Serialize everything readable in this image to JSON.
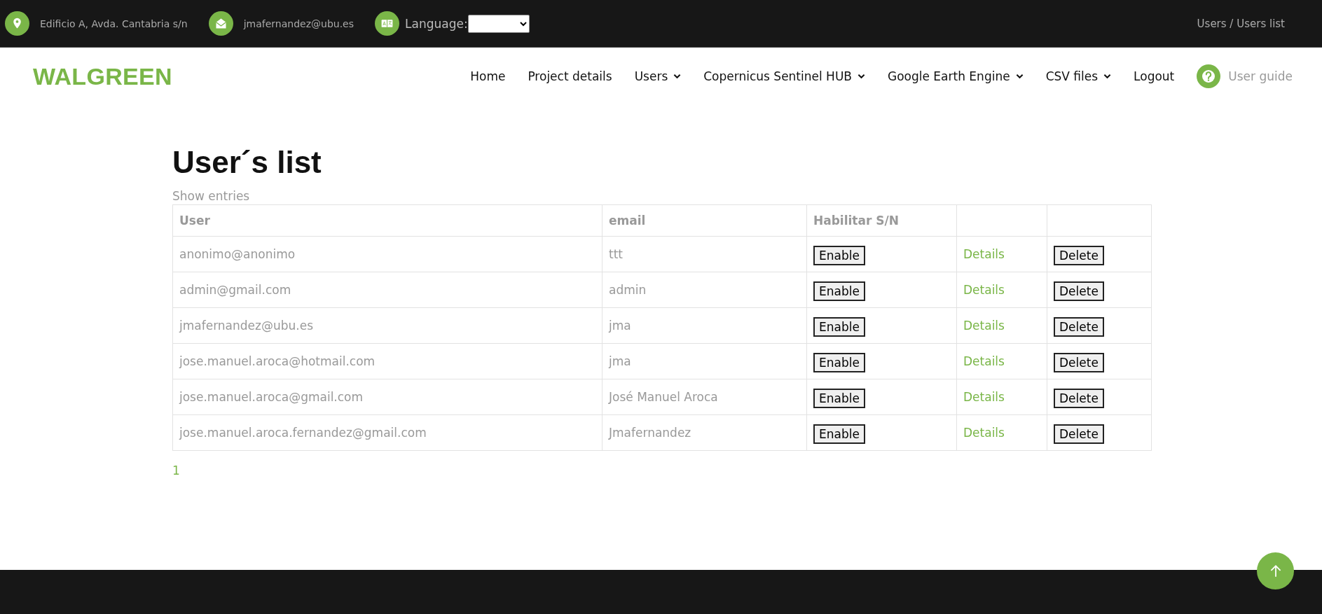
{
  "top_bar": {
    "address": "Edificio A, Avda. Cantabria s/n",
    "email": "jmafernandez@ubu.es",
    "language_label": "Language:",
    "breadcrumb": "Users / Users list"
  },
  "header": {
    "logo": "WALGREEN",
    "nav": [
      {
        "label": "Home",
        "dropdown": false
      },
      {
        "label": "Project details",
        "dropdown": false
      },
      {
        "label": "Users",
        "dropdown": true
      },
      {
        "label": "Copernicus Sentinel HUB",
        "dropdown": true
      },
      {
        "label": "Google Earth Engine",
        "dropdown": true
      },
      {
        "label": "CSV files",
        "dropdown": true
      },
      {
        "label": "Logout",
        "dropdown": false
      }
    ],
    "user_guide": "User guide"
  },
  "page_title": "User´s list",
  "show_entries": "Show entries",
  "table": {
    "columns": [
      "User",
      "email",
      "Habilitar S/N"
    ],
    "rows": [
      {
        "user": "anonimo@anonimo",
        "email": "ttt",
        "enable": "Enable",
        "details": "Details",
        "delete": "Delete"
      },
      {
        "user": "admin@gmail.com",
        "email": "admin",
        "enable": "Enable",
        "details": "Details",
        "delete": "Delete"
      },
      {
        "user": "jmafernandez@ubu.es",
        "email": "jma",
        "enable": "Enable",
        "details": "Details",
        "delete": "Delete"
      },
      {
        "user": "jose.manuel.aroca@hotmail.com",
        "email": "jma",
        "enable": "Enable",
        "details": "Details",
        "delete": "Delete"
      },
      {
        "user": "jose.manuel.aroca@gmail.com",
        "email": "José Manuel Aroca",
        "enable": "Enable",
        "details": "Details",
        "delete": "Delete"
      },
      {
        "user": "jose.manuel.aroca.fernandez@gmail.com",
        "email": "Jmafernandez",
        "enable": "Enable",
        "details": "Details",
        "delete": "Delete"
      }
    ]
  },
  "pagination": [
    {
      "label": "1",
      "selected": true
    }
  ]
}
